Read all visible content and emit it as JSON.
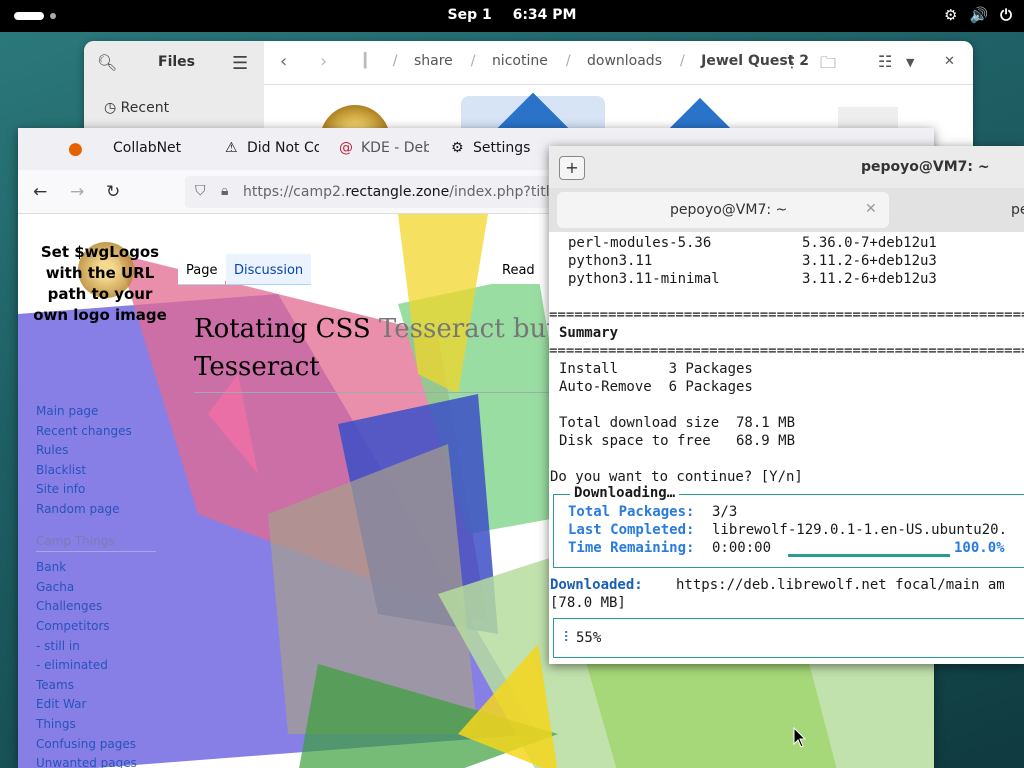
{
  "topbar": {
    "date": "Sep 1",
    "time": "6:34 PM",
    "tray_icons": [
      "network-icon",
      "volume-icon",
      "power-icon"
    ]
  },
  "files": {
    "title": "Files",
    "sidebar_recent": "Recent",
    "crumbs": [
      "share",
      "nicotine",
      "downloads",
      "Jewel Quest 2"
    ]
  },
  "firefox": {
    "tabs": [
      "CollabNet",
      "Did Not Co",
      "KDE - Deb",
      "Settings"
    ],
    "url_prefix": "https://camp2.",
    "url_domain": "rectangle.zone",
    "url_suffix": "/index.php?title"
  },
  "wiki": {
    "logo_text": "Set $wgLogos with the URL path to your own logo image",
    "tab_page": "Page",
    "tab_discussion": "Discussion",
    "read": "Read",
    "title_line1": "Rotating CSS ",
    "title_fade": "Tesseract but ev",
    "title_line2": "Tesseract",
    "nav": [
      "Main page",
      "Recent changes",
      "Rules",
      "Blacklist",
      "Site info",
      "Random page"
    ],
    "group": "Camp Things",
    "nav2": [
      "Bank",
      "Gacha",
      "Challenges",
      "Competitors",
      "- still in",
      "- eliminated",
      "Teams",
      "Edit War",
      "Things",
      "Confusing pages",
      "Unwanted pages"
    ]
  },
  "terminal": {
    "window_title": "pepoyo@VM7: ~",
    "tab1": "pepoyo@VM7: ~",
    "tab2": "pe",
    "packages": [
      {
        "name": "perl-modules-5.36",
        "version": "5.36.0-7+deb12u1"
      },
      {
        "name": "python3.11",
        "version": "3.11.2-6+deb12u3"
      },
      {
        "name": "python3.11-minimal",
        "version": "3.11.2-6+deb12u3"
      }
    ],
    "rule": "====================================================================",
    "summary": "Summary",
    "install": "Install      3 Packages",
    "autoremove": "Auto-Remove  6 Packages",
    "total_dl": "Total download size  78.1 MB",
    "disk": "Disk space to free   68.9 MB",
    "prompt": "Do you want to continue? [Y/n]",
    "dl_legend": "Downloading…",
    "total_pk_label": "Total Packages:",
    "total_pk_val": "3/3",
    "last_label": "Last Completed:",
    "last_val": "librewolf-129.0.1-1.en-US.ubuntu20.",
    "time_label": "Time Remaining:",
    "time_val": "0:00:00",
    "pct": "100.0%",
    "downloaded_label": "Downloaded:",
    "downloaded_url": "https://deb.librewolf.net focal/main am",
    "downloaded_size": "[78.0 MB]",
    "progress": "55%"
  }
}
